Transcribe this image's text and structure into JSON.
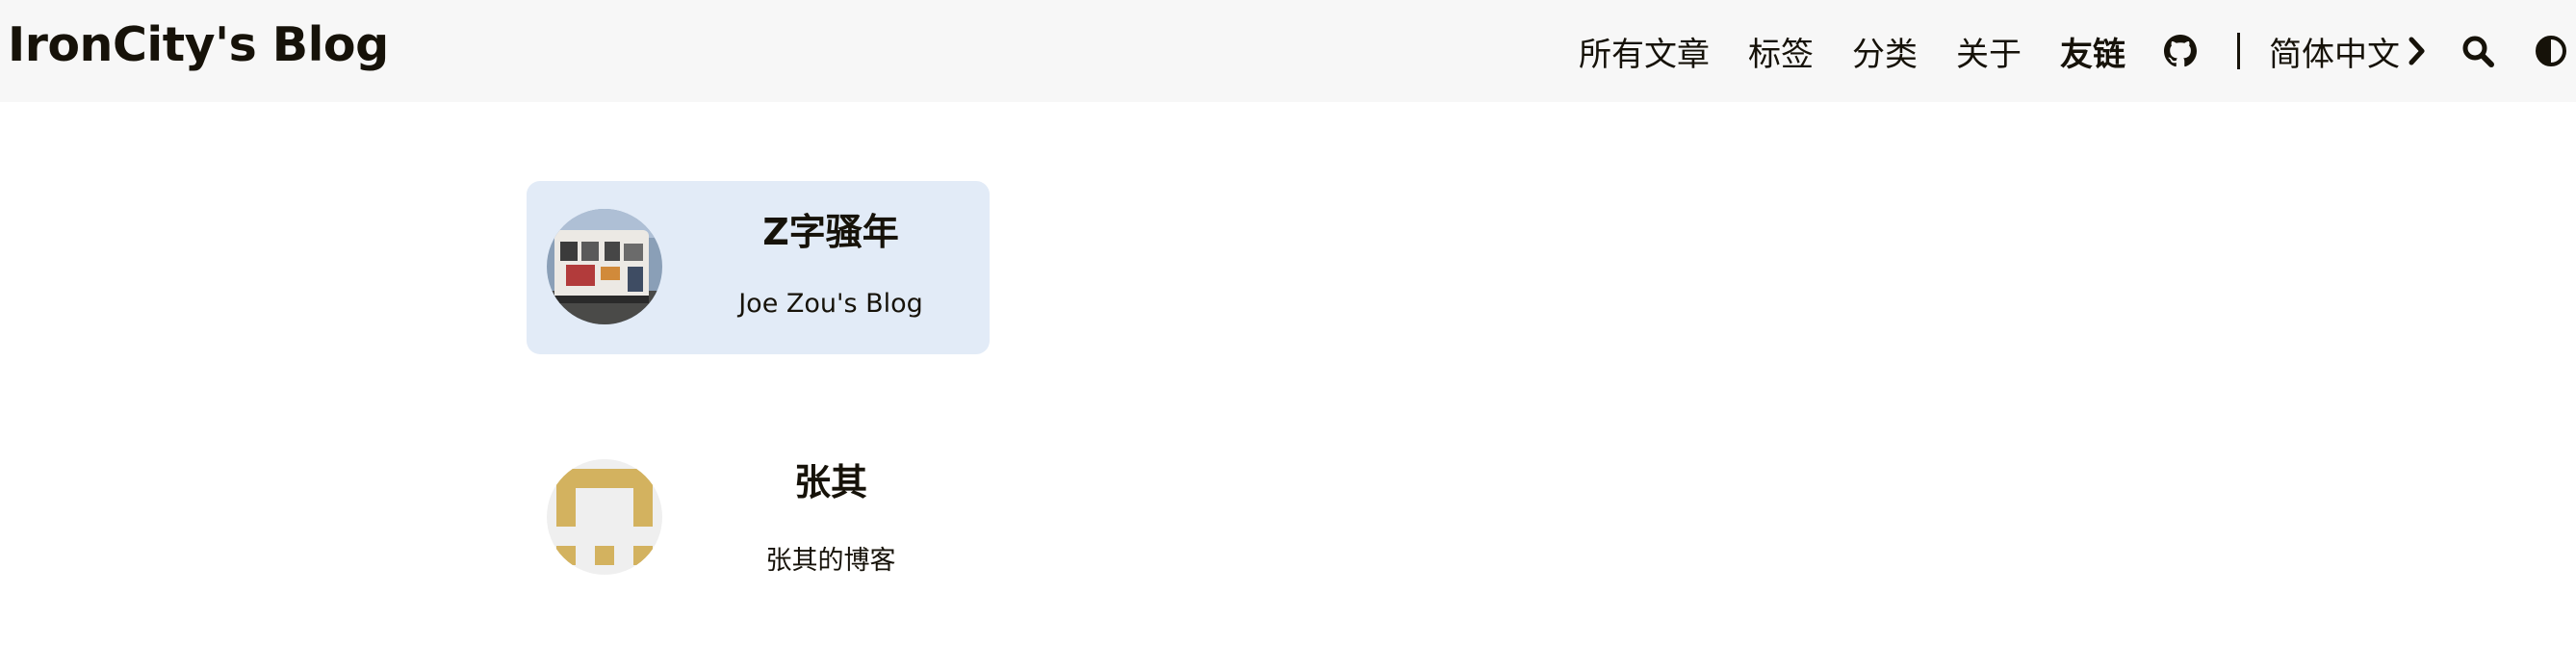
{
  "header": {
    "brand": "IronCity's Blog",
    "nav": [
      {
        "label": "所有文章",
        "active": false
      },
      {
        "label": "标签",
        "active": false
      },
      {
        "label": "分类",
        "active": false
      },
      {
        "label": "关于",
        "active": false
      },
      {
        "label": "友链",
        "active": true
      }
    ],
    "language": "简体中文",
    "icons": [
      "github-icon",
      "chevron-right-icon",
      "search-icon",
      "theme-toggle-icon"
    ]
  },
  "friends": [
    {
      "name": "Z字骚年",
      "description": "Joe Zou's Blog",
      "highlighted": true,
      "avatar": "train-photo"
    },
    {
      "name": "张其",
      "description": "张其的博客",
      "highlighted": false,
      "avatar": "identicon"
    }
  ],
  "colors": {
    "header_bg": "#f7f7f7",
    "text": "#161209",
    "card_highlight": "#e2ebf7",
    "identicon": "#d3b25f"
  }
}
